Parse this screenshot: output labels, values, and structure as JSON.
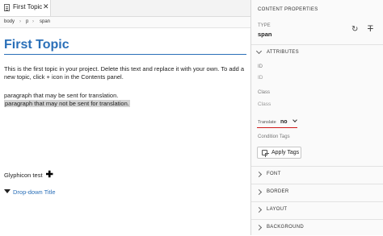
{
  "editor": {
    "tab": {
      "label": "First Topic",
      "close": "✕"
    },
    "breadcrumb": [
      "body",
      "p",
      "span"
    ],
    "title": "First Topic",
    "intro": "This is the first topic in your project. Delete this text and replace it with your own. To add a new topic, click + icon in the Contents panel.",
    "line_sent": "paragraph that may be sent for translation.",
    "line_not_sent": "paragraph that may not be sent for translation.",
    "glyphicon_text": "Glyphicon test",
    "glyphicon_symbol": "✚",
    "dropdown_title": "Drop-down Title"
  },
  "panel": {
    "header": "CONTENT PROPERTIES",
    "type_label": "TYPE",
    "type_value": "span",
    "refresh_icon": "↻",
    "clear_format_icon": "T",
    "attributes_label": "ATTRIBUTES",
    "id_label": "ID",
    "id_placeholder": "ID",
    "class_label": "Class",
    "class_placeholder": "Class",
    "translate_label": "Translate",
    "translate_value": "no",
    "condition_tags_label": "Condition Tags",
    "apply_tags_label": "Apply Tags",
    "sections": [
      "FONT",
      "BORDER",
      "LAYOUT",
      "BACKGROUND"
    ]
  },
  "colors": {
    "title_blue": "#2a6fb8",
    "highlight_gray": "#d4d4d4",
    "annotation_red": "#d01818"
  }
}
